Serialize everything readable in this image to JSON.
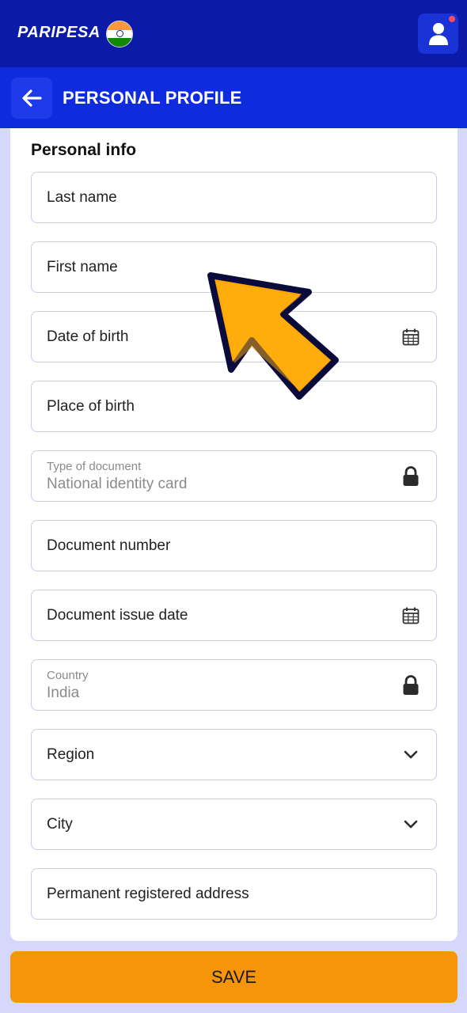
{
  "brand": {
    "logo_text": "PARIPESA",
    "flag": "india-flag-icon"
  },
  "topbar": {
    "profile_icon": "user-icon",
    "notification_color": "#ff4a5e"
  },
  "header": {
    "title": "PERSONAL PROFILE",
    "back_icon": "arrow-left-icon"
  },
  "section": {
    "title": "Personal info"
  },
  "fields": [
    {
      "label": "Last name",
      "type": "text"
    },
    {
      "label": "First name",
      "type": "text"
    },
    {
      "label": "Date of birth",
      "type": "date",
      "icon": "calendar-icon"
    },
    {
      "label": "Place of birth",
      "type": "text"
    },
    {
      "label": "Type of document",
      "value": "National identity card",
      "type": "locked",
      "icon": "lock-icon"
    },
    {
      "label": "Document number",
      "type": "text"
    },
    {
      "label": "Document issue date",
      "type": "date",
      "icon": "calendar-icon"
    },
    {
      "label": "Country",
      "value": "India",
      "type": "locked",
      "icon": "lock-icon"
    },
    {
      "label": "Region",
      "type": "select",
      "icon": "chevron-down-icon"
    },
    {
      "label": "City",
      "type": "select",
      "icon": "chevron-down-icon"
    },
    {
      "label": "Permanent registered address",
      "type": "text"
    }
  ],
  "save": {
    "label": "SAVE"
  },
  "colors": {
    "topbar": "#0b1ba8",
    "header": "#0f2be0",
    "accent": "#f7950a",
    "background": "#d6d8fb",
    "pointer": "#ffa600"
  }
}
